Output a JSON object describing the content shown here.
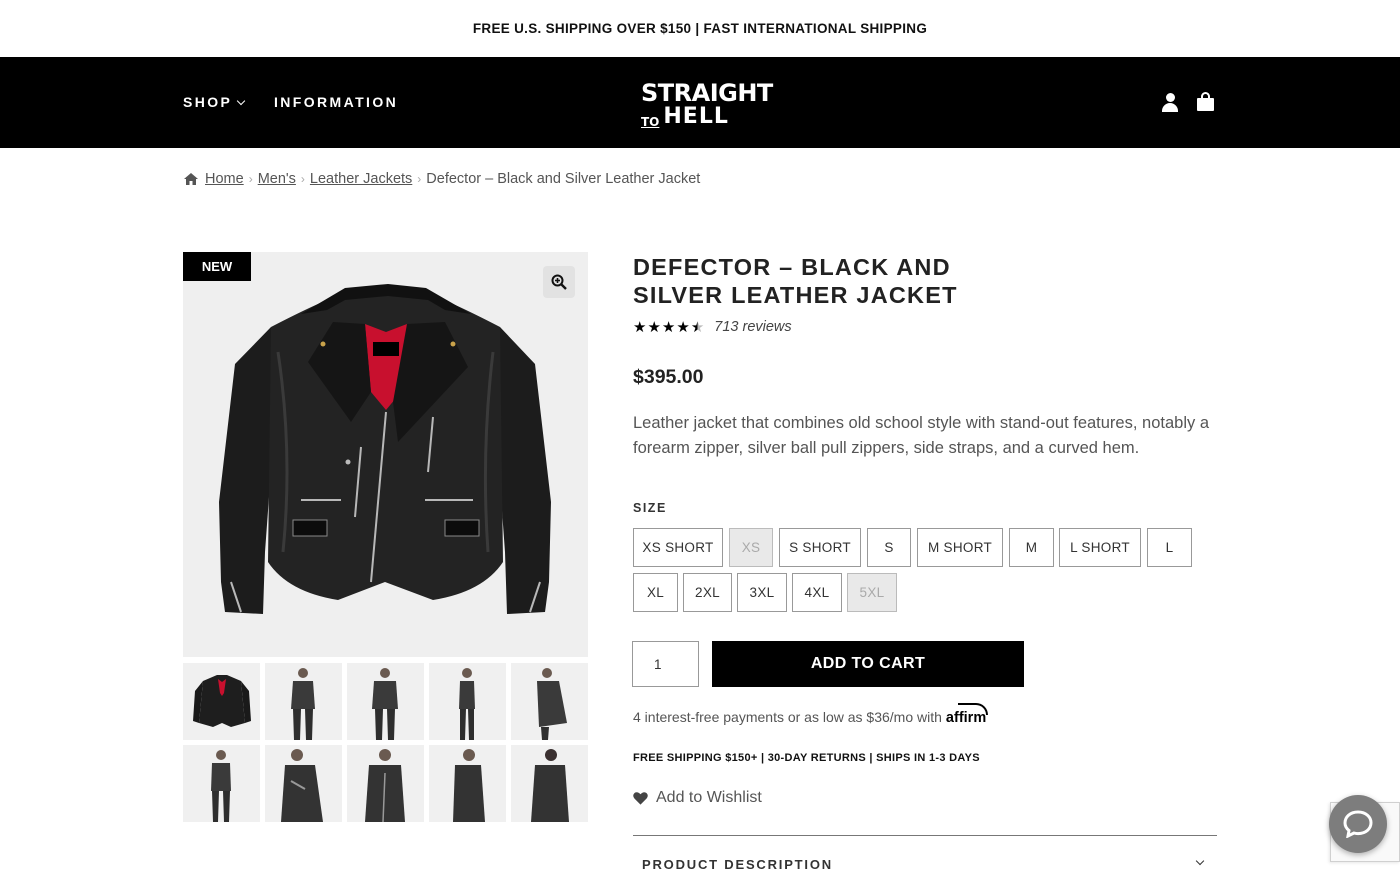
{
  "promo": {
    "text": "FREE U.S. SHIPPING OVER $150 | FAST INTERNATIONAL SHIPPING"
  },
  "nav": {
    "shop_label": "SHOP",
    "information_label": "INFORMATION",
    "logo_top": "STRAIGHT",
    "logo_to": "TO",
    "logo_bottom": "HELL"
  },
  "breadcrumb": {
    "items": [
      "Home",
      "Men's",
      "Leather Jackets"
    ],
    "current": "Defector – Black and Silver Leather Jacket"
  },
  "gallery": {
    "badge": "NEW",
    "thumbnail_count": 10
  },
  "product": {
    "title": "Defector – Black and Silver Leather Jacket",
    "rating": 4.5,
    "reviews": "713 reviews",
    "price": "$395.00",
    "description": "Leather jacket that combines old school style with stand-out features, notably a forearm zipper, silver ball pull zippers, side straps, and a curved hem."
  },
  "size": {
    "label": "SIZE",
    "options": [
      {
        "label": "XS SHORT",
        "disabled": false
      },
      {
        "label": "XS",
        "disabled": true
      },
      {
        "label": "S SHORT",
        "disabled": false
      },
      {
        "label": "S",
        "disabled": false
      },
      {
        "label": "M SHORT",
        "disabled": false
      },
      {
        "label": "M",
        "disabled": false
      },
      {
        "label": "L SHORT",
        "disabled": false
      },
      {
        "label": "L",
        "disabled": false
      },
      {
        "label": "XL",
        "disabled": false
      },
      {
        "label": "2XL",
        "disabled": false
      },
      {
        "label": "3XL",
        "disabled": false
      },
      {
        "label": "4XL",
        "disabled": false
      },
      {
        "label": "5XL",
        "disabled": true
      }
    ]
  },
  "cart": {
    "quantity": "1",
    "add_label": "ADD TO CART"
  },
  "affirm": {
    "text": "4 interest-free payments or as low as $36/mo with",
    "logo": "affirm"
  },
  "shipping_info": "FREE SHIPPING $150+ | 30-DAY RETURNS | SHIPS IN 1-3 DAYS",
  "wishlist_label": "Add to Wishlist",
  "product_description_label": "PRODUCT DESCRIPTION",
  "colors": {
    "nav_bg": "#000000",
    "button_bg": "#000000",
    "lining_red": "#c8102e",
    "disabled_size_bg": "#e9e9e9"
  },
  "icons": [
    "chevron-down-icon",
    "user-icon",
    "shopping-bag-icon",
    "home-icon",
    "zoom-icon",
    "star-icon",
    "heart-icon",
    "chat-icon"
  ]
}
